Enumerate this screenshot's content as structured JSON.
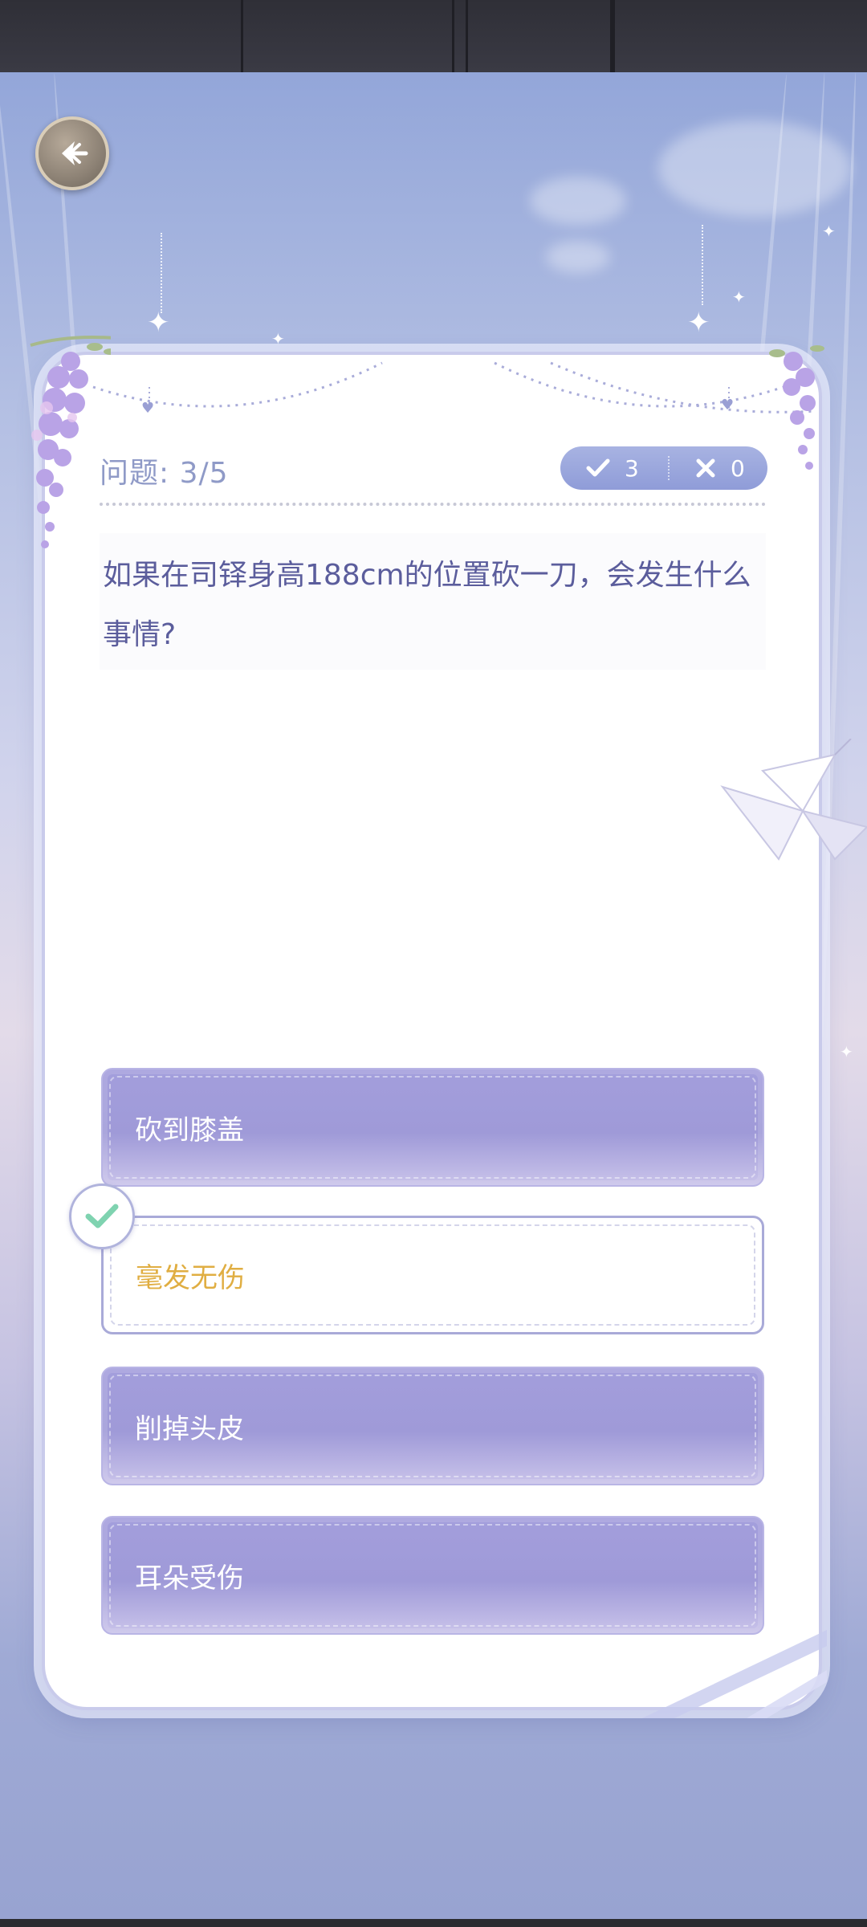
{
  "quiz": {
    "progress_label": "问题: 3/5",
    "correct_count": "3",
    "wrong_count": "0",
    "question": "如果在司铎身高188cm的位置砍一刀，会发生什么事情?",
    "options": [
      {
        "label": "砍到膝盖",
        "state": "normal"
      },
      {
        "label": "毫发无伤",
        "state": "correct"
      },
      {
        "label": "削掉头皮",
        "state": "normal"
      },
      {
        "label": "耳朵受伤",
        "state": "normal"
      }
    ]
  },
  "icons": {
    "back": "back-arrow-icon",
    "correct": "check-icon",
    "wrong": "cross-icon",
    "selected": "check-icon"
  },
  "colors": {
    "accent": "#a39edc",
    "correct_text": "#e0ae42",
    "question_text": "#5b5d9c",
    "progress_text": "#8f9ac7",
    "check_green": "#7fd3b0"
  }
}
